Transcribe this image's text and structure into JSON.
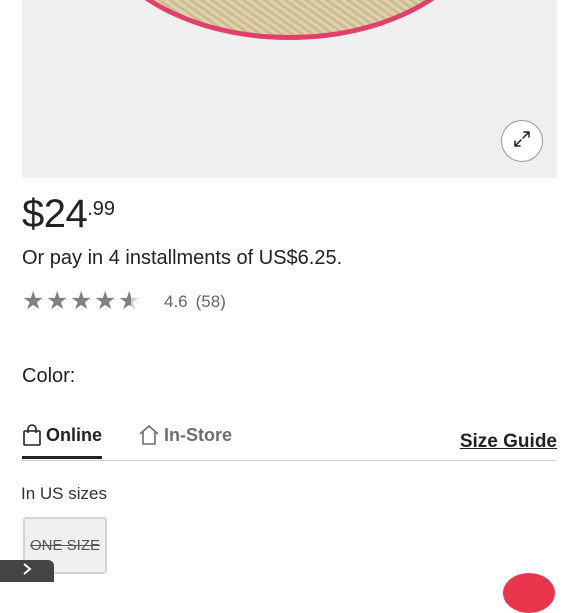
{
  "product": {
    "price_main": "$24",
    "price_cents": ".99",
    "installments": "Or pay in 4 installments of US$6.25.",
    "rating": {
      "value": "4.6",
      "count": "(58)",
      "stars": 4.6
    }
  },
  "color": {
    "label": "Color:"
  },
  "tabs": [
    {
      "label": "Online",
      "icon": "shopping-bag-icon",
      "active": true
    },
    {
      "label": "In-Store",
      "icon": "house-icon",
      "active": false
    }
  ],
  "size_guide": "Size Guide",
  "sizes": {
    "label": "In US sizes",
    "options": [
      {
        "label": "ONE SIZE",
        "available": false
      }
    ]
  },
  "icons": {
    "zoom": "expand-icon",
    "scroll": "chevron-right-icon",
    "chat": "chat-bubble-icon"
  },
  "colors": {
    "brim_pink": "#e0416b",
    "straw": "#d9c89a",
    "star_gray": "#808080",
    "chat_red": "#e8364d"
  }
}
